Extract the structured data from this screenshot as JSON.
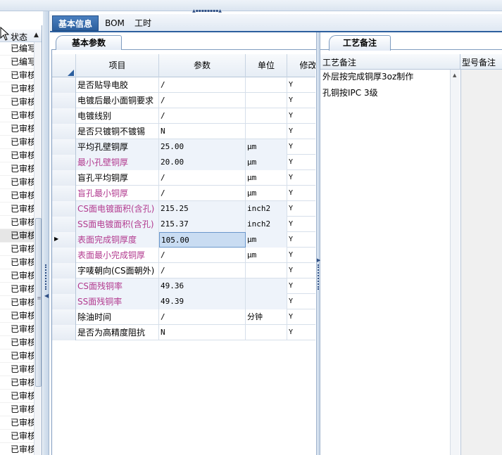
{
  "top_grip": "▲▪▪▪▪▪▪▪▪▲",
  "left_list": {
    "header": "状态",
    "rows": [
      "已编写",
      "已编写",
      "已审核",
      "已审核",
      "已审核",
      "已审核",
      "已审核",
      "已审核",
      "已审核",
      "已审核",
      "已审核",
      "已审核",
      "已审核",
      "已审核",
      "已审核",
      "已审核",
      "已审核",
      "已审核",
      "已审核",
      "已审核",
      "已审核",
      "已审核",
      "已审核",
      "已审核",
      "已审核",
      "已审核",
      "已审核",
      "已审核",
      "已审核",
      "已审核",
      "已审核"
    ],
    "selected_index": 14
  },
  "tabs": [
    {
      "label": "基本信息",
      "active": true
    },
    {
      "label": "BOM",
      "active": false
    },
    {
      "label": "工时",
      "active": false
    }
  ],
  "section_title": "基本参数",
  "grid": {
    "columns": {
      "item": "项目",
      "param": "参数",
      "unit": "单位",
      "modify": "修改"
    },
    "rows": [
      {
        "item": "是否贴导电胶",
        "param": "/",
        "unit": "",
        "modify": "Y",
        "highlight": false,
        "shade": false
      },
      {
        "item": "电镀后最小面铜要求",
        "param": "/",
        "unit": "",
        "modify": "Y",
        "highlight": false,
        "shade": false
      },
      {
        "item": "电镀线别",
        "param": "/",
        "unit": "",
        "modify": "Y",
        "highlight": false,
        "shade": false
      },
      {
        "item": "是否只镀铜不镀锡",
        "param": "N",
        "unit": "",
        "modify": "Y",
        "highlight": false,
        "shade": false
      },
      {
        "item": "平均孔壁铜厚",
        "param": "25.00",
        "unit": "μm",
        "modify": "Y",
        "highlight": false,
        "shade": true
      },
      {
        "item": "最小孔壁铜厚",
        "param": "20.00",
        "unit": "μm",
        "modify": "Y",
        "highlight": true,
        "shade": true
      },
      {
        "item": "盲孔平均铜厚",
        "param": "/",
        "unit": "μm",
        "modify": "Y",
        "highlight": false,
        "shade": false
      },
      {
        "item": "盲孔最小铜厚",
        "param": "/",
        "unit": "μm",
        "modify": "Y",
        "highlight": true,
        "shade": false
      },
      {
        "item": "CS面电镀面积(含孔)",
        "param": "215.25",
        "unit": "inch2",
        "modify": "Y",
        "highlight": true,
        "shade": true
      },
      {
        "item": "SS面电镀面积(含孔)",
        "param": "215.37",
        "unit": "inch2",
        "modify": "Y",
        "highlight": true,
        "shade": true
      },
      {
        "item": "表面完成铜厚度",
        "param": "105.00",
        "unit": "μm",
        "modify": "Y",
        "highlight": true,
        "shade": true,
        "current": true
      },
      {
        "item": "表面最小完成铜厚",
        "param": "/",
        "unit": "μm",
        "modify": "Y",
        "highlight": true,
        "shade": false
      },
      {
        "item": "字唛朝向(CS面朝外)",
        "param": "/",
        "unit": "",
        "modify": "Y",
        "highlight": false,
        "shade": false
      },
      {
        "item": "CS面残铜率",
        "param": "49.36",
        "unit": "",
        "modify": "Y",
        "highlight": true,
        "shade": true
      },
      {
        "item": "SS面残铜率",
        "param": "49.39",
        "unit": "",
        "modify": "Y",
        "highlight": true,
        "shade": true
      },
      {
        "item": "除油时间",
        "param": "/",
        "unit": "分钟",
        "modify": "Y",
        "highlight": false,
        "shade": false
      },
      {
        "item": "是否为高精度阻抗",
        "param": "N",
        "unit": "",
        "modify": "Y",
        "highlight": false,
        "shade": false
      }
    ]
  },
  "right_panel": {
    "tab": "工艺备注",
    "col_notes": "工艺备注",
    "col_model": "型号备注",
    "notes": [
      "外层按完成铜厚3oz制作",
      "孔铜按IPC 3级"
    ]
  },
  "icons": {
    "cursor": "mouse-pointer-icon",
    "sort": "sort-asc-icon",
    "row_pointer": "current-row-icon"
  }
}
